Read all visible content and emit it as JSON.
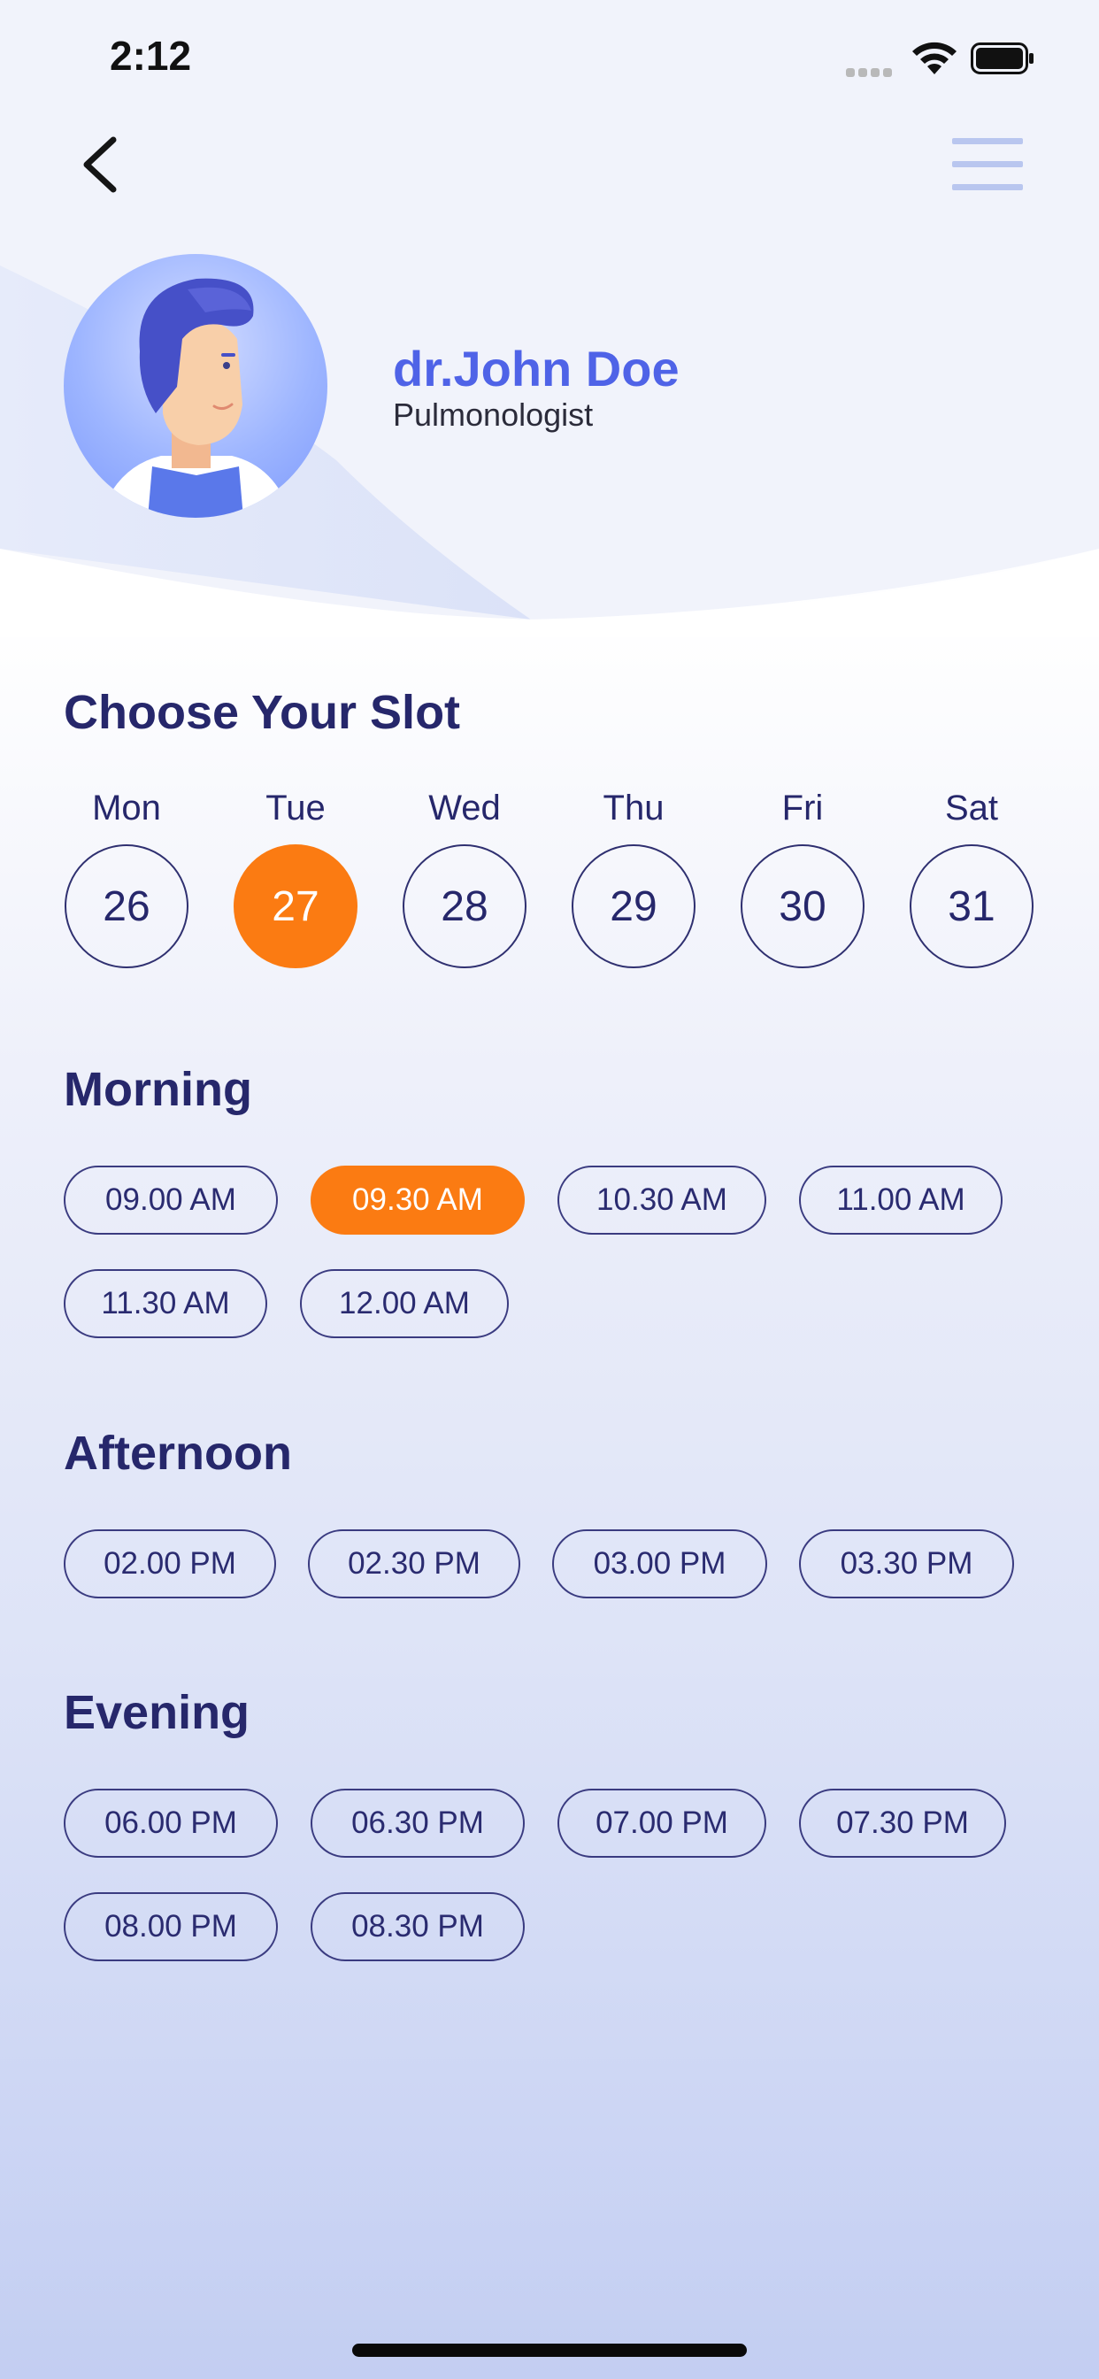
{
  "status_bar": {
    "time": "2:12"
  },
  "colors": {
    "accent": "#fb7b12",
    "primary_text": "#26276b",
    "doctor_name": "#4f63e7",
    "menu": "#b9c6ef"
  },
  "icons": {
    "back": "chevron-left-icon",
    "menu": "hamburger-menu-icon",
    "avatar": "doctor-illustration"
  },
  "doctor": {
    "name": "dr.John Doe",
    "specialty": "Pulmonologist"
  },
  "slot": {
    "title": "Choose Your Slot",
    "days": [
      {
        "day": "Mon",
        "date": "26",
        "selected": false
      },
      {
        "day": "Tue",
        "date": "27",
        "selected": true
      },
      {
        "day": "Wed",
        "date": "28",
        "selected": false
      },
      {
        "day": "Thu",
        "date": "29",
        "selected": false
      },
      {
        "day": "Fri",
        "date": "30",
        "selected": false
      },
      {
        "day": "Sat",
        "date": "31",
        "selected": false
      }
    ]
  },
  "morning": {
    "title": "Morning",
    "times": [
      "09.00 AM",
      "09.30 AM",
      "10.30 AM",
      "11.00 AM",
      "11.30 AM",
      "12.00 AM"
    ],
    "selected": "09.30 AM"
  },
  "afternoon": {
    "title": "Afternoon",
    "times": [
      "02.00 PM",
      "02.30 PM",
      "03.00 PM",
      "03.30 PM"
    ]
  },
  "evening": {
    "title": "Evening",
    "times": [
      "06.00 PM",
      "06.30 PM",
      "07.00 PM",
      "07.30 PM",
      "08.00 PM",
      "08.30 PM"
    ]
  }
}
